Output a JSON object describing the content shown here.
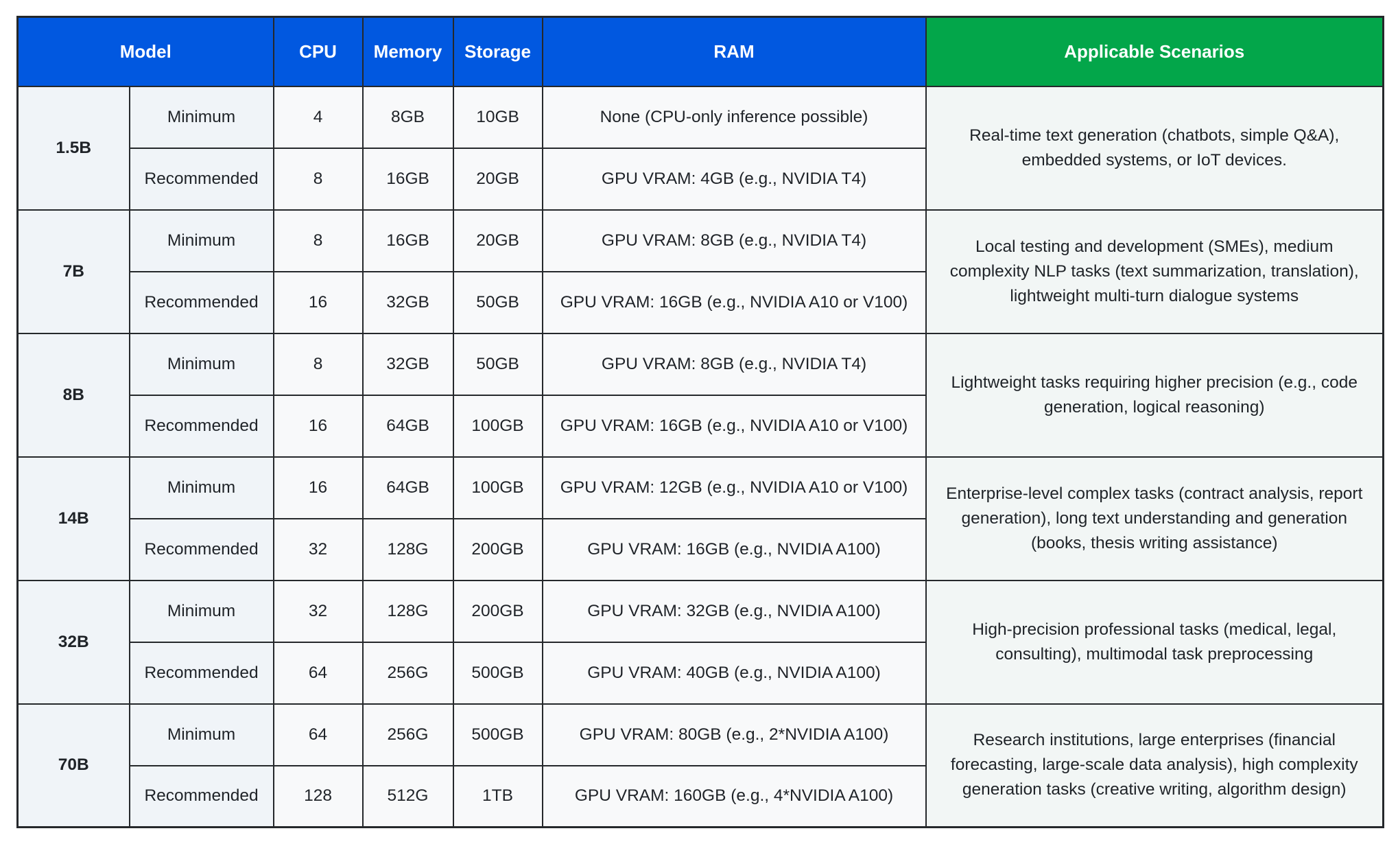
{
  "table": {
    "headers": {
      "model": "Model",
      "cpu": "CPU",
      "memory": "Memory",
      "storage": "Storage",
      "ram": "RAM",
      "scenarios": "Applicable Scenarios"
    },
    "colors": {
      "header_blue": "#0158e0",
      "header_green": "#03a64a"
    },
    "tiers": {
      "minimum": "Minimum",
      "recommended": "Recommended"
    },
    "models": [
      {
        "size_number": "1.5",
        "size_unit": "B",
        "minimum": {
          "cpu": "4",
          "memory": "8GB",
          "storage": "10GB",
          "ram": "None (CPU-only inference possible)"
        },
        "recommended": {
          "cpu": "8",
          "memory": "16GB",
          "storage": "20GB",
          "ram": "GPU VRAM: 4GB (e.g., NVIDIA T4)"
        },
        "scenarios": "Real-time text generation (chatbots, simple Q&A), embedded systems, or IoT devices."
      },
      {
        "size_number": "7",
        "size_unit": "B",
        "minimum": {
          "cpu": "8",
          "memory": "16GB",
          "storage": "20GB",
          "ram": "GPU VRAM: 8GB (e.g., NVIDIA T4)"
        },
        "recommended": {
          "cpu": "16",
          "memory": "32GB",
          "storage": "50GB",
          "ram": "GPU VRAM: 16GB (e.g., NVIDIA A10 or V100)"
        },
        "scenarios": "Local testing and development (SMEs), medium complexity NLP tasks (text summarization, translation), lightweight multi-turn dialogue systems"
      },
      {
        "size_number": "8",
        "size_unit": "B",
        "minimum": {
          "cpu": "8",
          "memory": "32GB",
          "storage": "50GB",
          "ram": "GPU VRAM: 8GB (e.g., NVIDIA T4)"
        },
        "recommended": {
          "cpu": "16",
          "memory": "64GB",
          "storage": "100GB",
          "ram": "GPU VRAM: 16GB (e.g., NVIDIA A10 or V100)"
        },
        "scenarios": "Lightweight tasks requiring higher precision (e.g., code generation, logical reasoning)"
      },
      {
        "size_number": "14",
        "size_unit": "B",
        "minimum": {
          "cpu": "16",
          "memory": "64GB",
          "storage": "100GB",
          "ram": "GPU VRAM: 12GB (e.g., NVIDIA A10 or V100)"
        },
        "recommended": {
          "cpu": "32",
          "memory": "128G",
          "storage": "200GB",
          "ram": "GPU VRAM: 16GB (e.g., NVIDIA A100)"
        },
        "scenarios": "Enterprise-level complex tasks (contract analysis, report generation), long text understanding and generation (books, thesis writing assistance)"
      },
      {
        "size_number": "32",
        "size_unit": "B",
        "minimum": {
          "cpu": "32",
          "memory": "128G",
          "storage": "200GB",
          "ram": "GPU VRAM: 32GB (e.g., NVIDIA A100)"
        },
        "recommended": {
          "cpu": "64",
          "memory": "256G",
          "storage": "500GB",
          "ram": "GPU VRAM: 40GB (e.g., NVIDIA A100)"
        },
        "scenarios": "High-precision professional tasks (medical, legal, consulting), multimodal task preprocessing"
      },
      {
        "size_number": "70",
        "size_unit": "B",
        "minimum": {
          "cpu": "64",
          "memory": "256G",
          "storage": "500GB",
          "ram": "GPU VRAM: 80GB (e.g., 2*NVIDIA A100)"
        },
        "recommended": {
          "cpu": "128",
          "memory": "512G",
          "storage": "1TB",
          "ram": "GPU VRAM: 160GB (e.g., 4*NVIDIA A100)"
        },
        "scenarios": "Research institutions, large enterprises (financial forecasting, large-scale data analysis), high complexity generation tasks (creative writing, algorithm design)"
      }
    ]
  }
}
